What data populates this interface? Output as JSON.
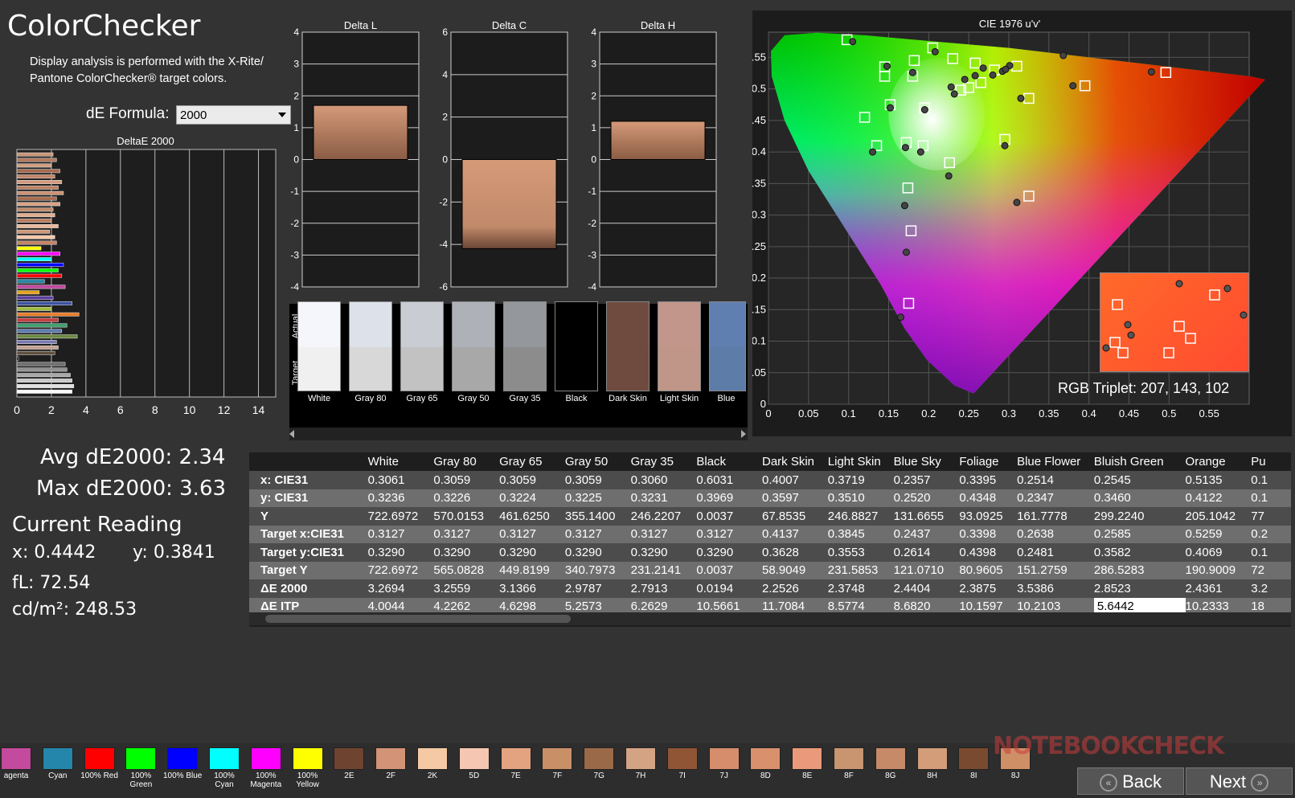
{
  "app": {
    "title": "ColorChecker"
  },
  "description": {
    "line1": "Display analysis is performed with the X-Rite/",
    "line2": "Pantone ColorChecker® target colors."
  },
  "formula": {
    "label": "dE Formula:",
    "value": "2000"
  },
  "deltae_chart": {
    "title": "DeltaE 2000",
    "ticks": [
      "0",
      "2",
      "4",
      "6",
      "8",
      "10",
      "12",
      "14"
    ],
    "xlim": [
      0,
      15
    ],
    "bars": [
      {
        "value": 2.1,
        "color": "#c99478"
      },
      {
        "value": 2.3,
        "color": "#b37a5e"
      },
      {
        "value": 2.0,
        "color": "#d2a07f"
      },
      {
        "value": 2.5,
        "color": "#a86a4f"
      },
      {
        "value": 2.2,
        "color": "#c28466"
      },
      {
        "value": 2.6,
        "color": "#d49a7c"
      },
      {
        "value": 2.4,
        "color": "#ba7f62"
      },
      {
        "value": 2.7,
        "color": "#cb9173"
      },
      {
        "value": 2.3,
        "color": "#a86c4f"
      },
      {
        "value": 2.5,
        "color": "#d8a285"
      },
      {
        "value": 2.1,
        "color": "#c08a6c"
      },
      {
        "value": 2.2,
        "color": "#e0ae90"
      },
      {
        "value": 2.0,
        "color": "#b77a5c"
      },
      {
        "value": 2.4,
        "color": "#e9b898"
      },
      {
        "value": 1.9,
        "color": "#d19676"
      },
      {
        "value": 2.2,
        "color": "#f5c9a8"
      },
      {
        "value": 2.3,
        "color": "#c58365"
      },
      {
        "value": 1.4,
        "color": "#ffff00"
      },
      {
        "value": 2.5,
        "color": "#ff00ff"
      },
      {
        "value": 2.0,
        "color": "#00ffff"
      },
      {
        "value": 2.7,
        "color": "#0000ff"
      },
      {
        "value": 2.4,
        "color": "#00ff00"
      },
      {
        "value": 2.6,
        "color": "#ff0000"
      },
      {
        "value": 1.6,
        "color": "#2a86a6"
      },
      {
        "value": 2.8,
        "color": "#c14aa0"
      },
      {
        "value": 1.3,
        "color": "#e4a21f"
      },
      {
        "value": 2.1,
        "color": "#5a3e9c"
      },
      {
        "value": 3.2,
        "color": "#3a52a0"
      },
      {
        "value": 2.0,
        "color": "#9cbb3f"
      },
      {
        "value": 3.6,
        "color": "#e87c2a"
      },
      {
        "value": 2.4,
        "color": "#c84040"
      },
      {
        "value": 2.9,
        "color": "#3fa070"
      },
      {
        "value": 2.6,
        "color": "#5e7db0"
      },
      {
        "value": 3.5,
        "color": "#6a8a40"
      },
      {
        "value": 2.3,
        "color": "#7a7ab0"
      },
      {
        "value": 2.4,
        "color": "#c2a090"
      },
      {
        "value": 2.2,
        "color": "#60503f"
      },
      {
        "value": 0.1,
        "color": "#101010"
      },
      {
        "value": 2.8,
        "color": "#707070"
      },
      {
        "value": 2.9,
        "color": "#909090"
      },
      {
        "value": 3.1,
        "color": "#a8a8a8"
      },
      {
        "value": 3.2,
        "color": "#c8c8c8"
      },
      {
        "value": 3.3,
        "color": "#e0e0e0"
      },
      {
        "value": 3.2,
        "color": "#f8f8f8"
      }
    ]
  },
  "stats": {
    "avg": "Avg dE2000: 2.34",
    "max": "Max dE2000: 3.63"
  },
  "reading": {
    "title": "Current Reading",
    "x": "x: 0.4442",
    "y": "y: 0.3841",
    "fl": "fL: 72.54",
    "cdm2": "cd/m²: 248.53"
  },
  "delta_charts": [
    {
      "title": "Delta L",
      "ylim": [
        -4,
        4
      ],
      "ticks": [
        "4",
        "3",
        "2",
        "1",
        "0",
        "-1",
        "-2",
        "-3",
        "-4"
      ],
      "value": 1.7
    },
    {
      "title": "Delta C",
      "ylim": [
        -6,
        6
      ],
      "ticks": [
        "6",
        "4",
        "2",
        "0",
        "-2",
        "-4",
        "-6"
      ],
      "value": -4.2
    },
    {
      "title": "Delta H",
      "ylim": [
        -4,
        4
      ],
      "ticks": [
        "4",
        "3",
        "2",
        "1",
        "0",
        "-1",
        "-2",
        "-3",
        "-4"
      ],
      "value": 1.2
    }
  ],
  "swatch_panel": {
    "actual_label": "Actual",
    "target_label": "Target",
    "swatches": [
      {
        "label": "White",
        "actual": "#f4f6fb",
        "target": "#f0f0f0"
      },
      {
        "label": "Gray 80",
        "actual": "#dde1ea",
        "target": "#d8d8d8"
      },
      {
        "label": "Gray 65",
        "actual": "#c9ccd2",
        "target": "#c2c2c2"
      },
      {
        "label": "Gray 50",
        "actual": "#aeb1b7",
        "target": "#a8a8a8"
      },
      {
        "label": "Gray 35",
        "actual": "#94979b",
        "target": "#8c8c8c"
      },
      {
        "label": "Black",
        "actual": "#000000",
        "target": "#000000"
      },
      {
        "label": "Dark Skin",
        "actual": "#6f4b3f",
        "target": "#6e4b3e"
      },
      {
        "label": "Light Skin",
        "actual": "#c2968a",
        "target": "#c09688"
      },
      {
        "label": "Blue",
        "actual": "#5e7fb0",
        "target": "#5d7ca8"
      }
    ]
  },
  "cie": {
    "title": "CIE 1976 u'v'",
    "xticks": [
      "0",
      "0.05",
      "0.1",
      "0.15",
      "0.2",
      "0.25",
      "0.3",
      "0.35",
      "0.4",
      "0.45",
      "0.5",
      "0.55"
    ],
    "yticks": [
      "0.55",
      "0.5",
      "0.45",
      "0.4",
      "0.35",
      "0.3",
      "0.25",
      "0.2",
      "0.15",
      "0.1",
      "0.05",
      "0"
    ],
    "xlim": [
      0,
      0.6
    ],
    "ylim": [
      0,
      0.59
    ],
    "targets": [
      [
        0.098,
        0.578
      ],
      [
        0.145,
        0.535
      ],
      [
        0.182,
        0.545
      ],
      [
        0.205,
        0.565
      ],
      [
        0.23,
        0.548
      ],
      [
        0.258,
        0.541
      ],
      [
        0.282,
        0.53
      ],
      [
        0.31,
        0.536
      ],
      [
        0.145,
        0.52
      ],
      [
        0.18,
        0.52
      ],
      [
        0.195,
        0.47
      ],
      [
        0.152,
        0.475
      ],
      [
        0.12,
        0.455
      ],
      [
        0.135,
        0.41
      ],
      [
        0.172,
        0.415
      ],
      [
        0.193,
        0.41
      ],
      [
        0.226,
        0.383
      ],
      [
        0.174,
        0.343
      ],
      [
        0.178,
        0.275
      ],
      [
        0.175,
        0.16
      ],
      [
        0.295,
        0.42
      ],
      [
        0.325,
        0.33
      ],
      [
        0.325,
        0.485
      ],
      [
        0.395,
        0.505
      ],
      [
        0.496,
        0.526
      ],
      [
        0.25,
        0.502
      ],
      [
        0.265,
        0.51
      ],
      [
        0.24,
        0.498
      ]
    ],
    "measured": [
      [
        0.105,
        0.575
      ],
      [
        0.148,
        0.536
      ],
      [
        0.18,
        0.526
      ],
      [
        0.208,
        0.559
      ],
      [
        0.268,
        0.533
      ],
      [
        0.292,
        0.528
      ],
      [
        0.301,
        0.537
      ],
      [
        0.368,
        0.553
      ],
      [
        0.152,
        0.47
      ],
      [
        0.195,
        0.467
      ],
      [
        0.13,
        0.4
      ],
      [
        0.171,
        0.407
      ],
      [
        0.19,
        0.4
      ],
      [
        0.225,
        0.362
      ],
      [
        0.17,
        0.315
      ],
      [
        0.172,
        0.241
      ],
      [
        0.165,
        0.138
      ],
      [
        0.295,
        0.41
      ],
      [
        0.31,
        0.32
      ],
      [
        0.315,
        0.485
      ],
      [
        0.38,
        0.505
      ],
      [
        0.478,
        0.527
      ],
      [
        0.228,
        0.503
      ],
      [
        0.258,
        0.521
      ],
      [
        0.28,
        0.522
      ],
      [
        0.245,
        0.515
      ],
      [
        0.232,
        0.492
      ],
      [
        0.296,
        0.531
      ]
    ],
    "rgb_triplet": "RGB Triplet: 207, 143, 102"
  },
  "table": {
    "columns": [
      "White",
      "Gray 80",
      "Gray 65",
      "Gray 50",
      "Gray 35",
      "Black",
      "Dark Skin",
      "Light Skin",
      "Blue Sky",
      "Foliage",
      "Blue Flower",
      "Bluish Green",
      "Orange",
      "Pu"
    ],
    "rows": [
      {
        "label": "x: CIE31",
        "values": [
          "0.3061",
          "0.3059",
          "0.3059",
          "0.3059",
          "0.3060",
          "0.6031",
          "0.4007",
          "0.3719",
          "0.2357",
          "0.3395",
          "0.2514",
          "0.2545",
          "0.5135",
          "0.1"
        ]
      },
      {
        "label": "y: CIE31",
        "values": [
          "0.3236",
          "0.3226",
          "0.3224",
          "0.3225",
          "0.3231",
          "0.3969",
          "0.3597",
          "0.3510",
          "0.2520",
          "0.4348",
          "0.2347",
          "0.3460",
          "0.4122",
          "0.1"
        ]
      },
      {
        "label": "Y",
        "values": [
          "722.6972",
          "570.0153",
          "461.6250",
          "355.1400",
          "246.2207",
          "0.0037",
          "67.8535",
          "246.8827",
          "131.6655",
          "93.0925",
          "161.7778",
          "299.2240",
          "205.1042",
          "77"
        ]
      },
      {
        "label": "Target x:CIE31",
        "values": [
          "0.3127",
          "0.3127",
          "0.3127",
          "0.3127",
          "0.3127",
          "0.3127",
          "0.4137",
          "0.3845",
          "0.2437",
          "0.3398",
          "0.2638",
          "0.2585",
          "0.5259",
          "0.2"
        ]
      },
      {
        "label": "Target y:CIE31",
        "values": [
          "0.3290",
          "0.3290",
          "0.3290",
          "0.3290",
          "0.3290",
          "0.3290",
          "0.3628",
          "0.3553",
          "0.2614",
          "0.4398",
          "0.2481",
          "0.3582",
          "0.4069",
          "0.1"
        ]
      },
      {
        "label": "Target Y",
        "values": [
          "722.6972",
          "565.0828",
          "449.8199",
          "340.7973",
          "231.2141",
          "0.0037",
          "58.9049",
          "231.5853",
          "121.0710",
          "80.9605",
          "151.2759",
          "286.5283",
          "190.9009",
          "72"
        ]
      },
      {
        "label": "ΔE 2000",
        "values": [
          "3.2694",
          "3.2559",
          "3.1366",
          "2.9787",
          "2.7913",
          "0.0194",
          "2.2526",
          "2.3748",
          "2.4404",
          "2.3875",
          "3.5386",
          "2.8523",
          "2.4361",
          "3.2"
        ]
      },
      {
        "label": "ΔE ITP",
        "values": [
          "4.0044",
          "4.2262",
          "4.6298",
          "5.2573",
          "6.2629",
          "10.5661",
          "11.7084",
          "8.5774",
          "8.6820",
          "10.1597",
          "10.2103",
          "5.6442",
          "10.2333",
          "18"
        ]
      }
    ]
  },
  "bottom_swatches": [
    {
      "label": "agenta",
      "color": "#c34a9c"
    },
    {
      "label": "Cyan",
      "color": "#2486aa"
    },
    {
      "label": "100% Red",
      "color": "#ff0000"
    },
    {
      "label": "100% Green",
      "color": "#00ff00"
    },
    {
      "label": "100% Blue",
      "color": "#0000ff"
    },
    {
      "label": "100% Cyan",
      "color": "#00ffff"
    },
    {
      "label": "100% Magenta",
      "color": "#ff00ff"
    },
    {
      "label": "100% Yellow",
      "color": "#ffff00"
    },
    {
      "label": "2E",
      "color": "#6e4330"
    },
    {
      "label": "2F",
      "color": "#d39376"
    },
    {
      "label": "2K",
      "color": "#f4c9a3"
    },
    {
      "label": "5D",
      "color": "#f5c6b1"
    },
    {
      "label": "7E",
      "color": "#e4a380"
    },
    {
      "label": "7F",
      "color": "#c99068"
    },
    {
      "label": "7G",
      "color": "#9a6a48"
    },
    {
      "label": "7H",
      "color": "#d4a384"
    },
    {
      "label": "7I",
      "color": "#8f5535"
    },
    {
      "label": "7J",
      "color": "#d58d6b"
    },
    {
      "label": "8D",
      "color": "#d9906c"
    },
    {
      "label": "8E",
      "color": "#ea9a7a"
    },
    {
      "label": "8F",
      "color": "#c99470"
    },
    {
      "label": "8G",
      "color": "#c68a68"
    },
    {
      "label": "8H",
      "color": "#d29d78"
    },
    {
      "label": "8I",
      "color": "#7a4a30"
    },
    {
      "label": "8J",
      "color": "#cf8f66"
    }
  ],
  "nav": {
    "back": "Back",
    "next": "Next"
  },
  "watermark": "NOTEBOOKCHECK"
}
